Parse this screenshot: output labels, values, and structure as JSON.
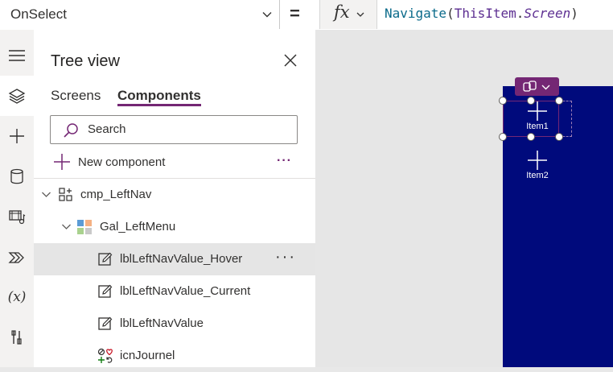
{
  "formula_bar": {
    "property": "OnSelect",
    "equals": "=",
    "fx_label": "fx",
    "formula": {
      "fn": "Navigate",
      "open": "(",
      "obj": "ThisItem",
      "dot": ".",
      "prop": "Screen",
      "close": ")"
    }
  },
  "rail": {
    "items": [
      {
        "icon": "hamburger-icon"
      },
      {
        "icon": "layers-icon",
        "selected": true
      },
      {
        "icon": "plus-icon"
      },
      {
        "icon": "database-icon"
      },
      {
        "icon": "media-icon"
      },
      {
        "icon": "power-automate-icon"
      },
      {
        "icon": "variables-icon",
        "text": "(x)"
      },
      {
        "icon": "tools-icon"
      }
    ]
  },
  "tree": {
    "title": "Tree view",
    "tabs": [
      {
        "label": "Screens",
        "active": false
      },
      {
        "label": "Components",
        "active": true
      }
    ],
    "search_placeholder": "Search",
    "new_component": "New component",
    "more": "···",
    "rows": [
      {
        "label": "cmp_LeftNav",
        "icon": "component-icon",
        "expanded": true,
        "level": 0
      },
      {
        "label": "Gal_LeftMenu",
        "icon": "gallery-icon",
        "expanded": true,
        "level": 1
      },
      {
        "label": "lblLeftNavValue_Hover",
        "icon": "label-edit-icon",
        "level": 2,
        "hover": true
      },
      {
        "label": "lblLeftNavValue_Current",
        "icon": "label-edit-icon",
        "level": 2
      },
      {
        "label": "lblLeftNavValue",
        "icon": "label-edit-icon",
        "level": 2
      },
      {
        "label": "icnJournel",
        "icon": "icons-icon",
        "level": 2
      }
    ],
    "row_more": "···"
  },
  "canvas": {
    "items": [
      {
        "label": "Item1"
      },
      {
        "label": "Item2"
      }
    ]
  },
  "colors": {
    "accent": "#742774",
    "screen": "#000a7c"
  }
}
